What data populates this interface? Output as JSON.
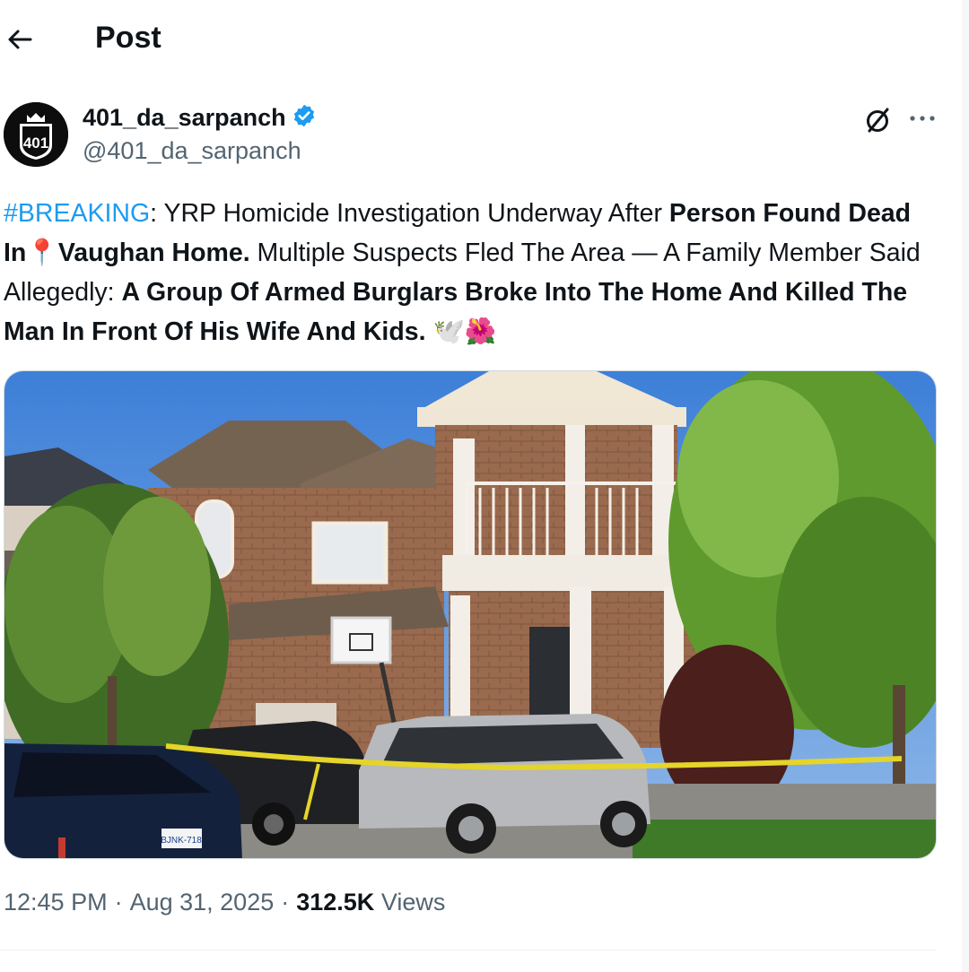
{
  "header": {
    "title": "Post"
  },
  "author": {
    "display_name": "401_da_sarpanch",
    "handle": "@401_da_sarpanch",
    "avatar_text": "401",
    "verified": true
  },
  "post": {
    "hashtag": "#BREAKING",
    "seg1": ": YRP Homicide Investigation Underway After ",
    "seg2_bold": "Person Found Dead In",
    "pin_emoji": "📍",
    "seg3_bold": "Vaughan Home.",
    "seg4": " Multiple Suspects Fled The Area — A Family Member Said Allegedly: ",
    "seg5_bold": "A Group Of Armed Burglars Broke Into The Home And Killed The Man In Front Of His Wife And Kids.",
    "trailing_emojis": "🕊️🌺"
  },
  "media": {
    "alt": "Brick house with police tape, police SUV and silver SUV in driveway",
    "plate_text": "BJNK-718"
  },
  "meta": {
    "time": "12:45 PM",
    "sep1": "·",
    "date": "Aug 31, 2025",
    "sep2": "·",
    "views_count": "312.5K",
    "views_label": "Views"
  },
  "colors": {
    "link": "#1d9bf0",
    "muted": "#536471",
    "text": "#0f1419",
    "verified": "#1d9bf0"
  },
  "icons": [
    "back-arrow-icon",
    "verified-badge-icon",
    "grok-icon",
    "more-icon"
  ]
}
